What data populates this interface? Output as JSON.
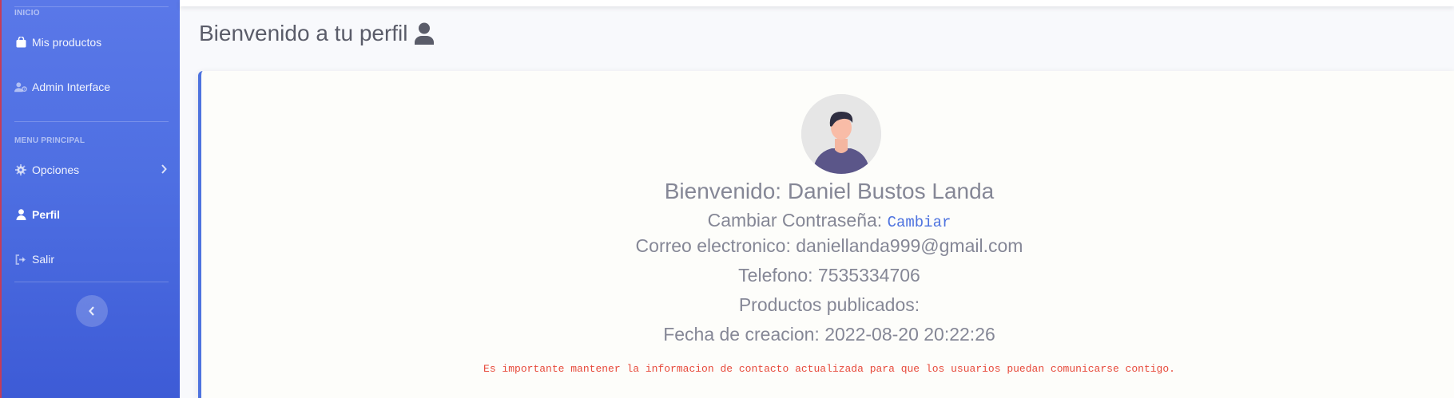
{
  "sidebar": {
    "heading_inicio": "INICIO",
    "heading_menu": "MENU PRINCIPAL",
    "items": [
      {
        "label": "Mis productos",
        "icon": "shopping-bag-icon"
      },
      {
        "label": "Admin Interface",
        "icon": "user-cog-icon"
      },
      {
        "label": "Opciones",
        "icon": "gear-icon"
      },
      {
        "label": "Perfil",
        "icon": "user-icon"
      },
      {
        "label": "Salir",
        "icon": "sign-out-icon"
      }
    ],
    "toggle_icon": "chevron-left-icon"
  },
  "page": {
    "title": "Bienvenido a tu perfil",
    "title_icon": "user-icon"
  },
  "profile": {
    "welcome": "Bienvenido: Daniel Bustos Landa",
    "password_label": "Cambiar Contraseña:",
    "password_link": "Cambiar",
    "email": "Correo electronico: daniellanda999@gmail.com",
    "phone": "Telefono: 7535334706",
    "products": "Productos publicados:",
    "created": "Fecha de creacion: 2022-08-20 20:22:26",
    "note": "Es importante mantener la informacion de contacto actualizada para que los usuarios puedan comunicarse contigo."
  },
  "colors": {
    "primary": "#4e73df",
    "text_gray": "#858796",
    "danger": "#e74a3b"
  }
}
